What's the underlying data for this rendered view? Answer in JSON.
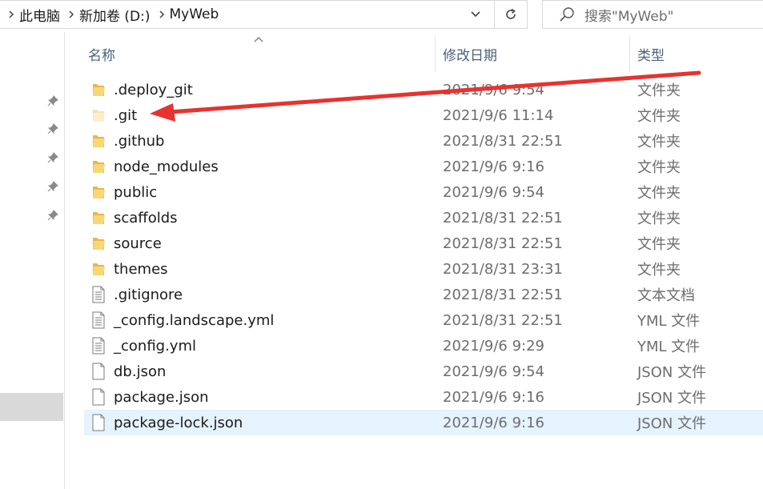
{
  "breadcrumb": [
    "此电脑",
    "新加卷 (D:)",
    "MyWeb"
  ],
  "search": {
    "placeholder": "搜索\"MyWeb\""
  },
  "columns": {
    "name": "名称",
    "modified": "修改日期",
    "type": "类型"
  },
  "files": [
    {
      "name": ".deploy_git",
      "modified": "2021/9/6 9:54",
      "type": "文件夹",
      "icon": "folder-icon"
    },
    {
      "name": ".git",
      "modified": "2021/9/6 11:14",
      "type": "文件夹",
      "icon": "folder-hidden-icon"
    },
    {
      "name": ".github",
      "modified": "2021/8/31 22:51",
      "type": "文件夹",
      "icon": "folder-icon"
    },
    {
      "name": "node_modules",
      "modified": "2021/9/6 9:16",
      "type": "文件夹",
      "icon": "folder-icon"
    },
    {
      "name": "public",
      "modified": "2021/9/6 9:54",
      "type": "文件夹",
      "icon": "folder-icon"
    },
    {
      "name": "scaffolds",
      "modified": "2021/8/31 22:51",
      "type": "文件夹",
      "icon": "folder-icon"
    },
    {
      "name": "source",
      "modified": "2021/8/31 22:51",
      "type": "文件夹",
      "icon": "folder-icon"
    },
    {
      "name": "themes",
      "modified": "2021/8/31 23:31",
      "type": "文件夹",
      "icon": "folder-icon"
    },
    {
      "name": ".gitignore",
      "modified": "2021/8/31 22:51",
      "type": "文本文档",
      "icon": "text-file-icon"
    },
    {
      "name": "_config.landscape.yml",
      "modified": "2021/8/31 22:51",
      "type": "YML 文件",
      "icon": "text-file-icon"
    },
    {
      "name": "_config.yml",
      "modified": "2021/9/6 9:29",
      "type": "YML 文件",
      "icon": "text-file-icon"
    },
    {
      "name": "db.json",
      "modified": "2021/9/6 9:54",
      "type": "JSON 文件",
      "icon": "file-icon"
    },
    {
      "name": "package.json",
      "modified": "2021/9/6 9:16",
      "type": "JSON 文件",
      "icon": "file-icon"
    },
    {
      "name": "package-lock.json",
      "modified": "2021/9/6 9:16",
      "type": "JSON 文件",
      "icon": "file-icon"
    }
  ],
  "selected_index": 13,
  "colors": {
    "selection": "#e5f3ff",
    "folder": "#f8d775",
    "arrow": "#e8322f",
    "header_text": "#4c607a"
  }
}
